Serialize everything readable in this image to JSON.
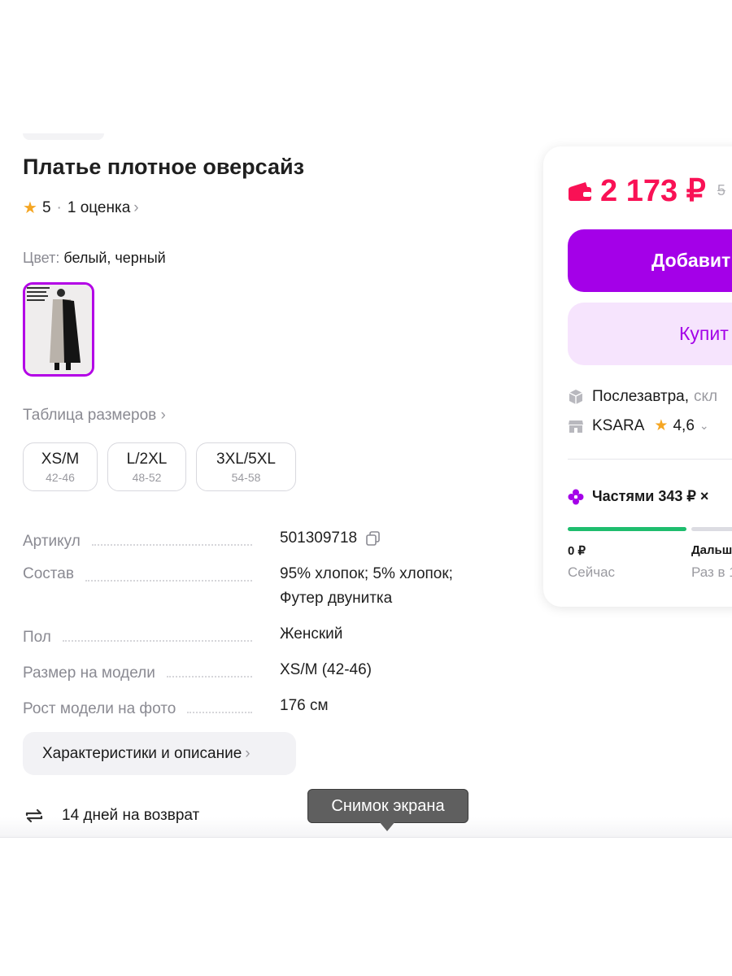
{
  "product": {
    "title": "Платье плотное оверсайз",
    "rating": "5",
    "reviews": "1 оценка",
    "color_label": "Цвет:",
    "color_value": "белый, черный"
  },
  "sizes": {
    "table_link": "Таблица размеров",
    "options": [
      {
        "size": "XS/M",
        "range": "42-46"
      },
      {
        "size": "L/2XL",
        "range": "48-52"
      },
      {
        "size": "3XL/5XL",
        "range": "54-58"
      }
    ]
  },
  "specs": [
    {
      "key": "Артикул",
      "value": "501309718"
    },
    {
      "key": "Состав",
      "value": "95% хлопок; 5% хлопок; Футер двунитка"
    },
    {
      "key": "Пол",
      "value": "Женский"
    },
    {
      "key": "Размер на модели",
      "value": "XS/M (42-46)"
    },
    {
      "key": "Рост модели на фото",
      "value": "176 см"
    }
  ],
  "description_button": "Характеристики и описание",
  "return_policy": "14 дней на возврат",
  "tooltip": "Снимок экрана",
  "card": {
    "price": "2 173 ₽",
    "old_price": "5",
    "add_button": "Добавит",
    "buy_button": "Купит",
    "delivery": "Послезавтра,",
    "delivery_extra": "скл",
    "seller_name": "KSARA",
    "seller_rating": "4,6",
    "installments": "Частями 343 ₽ ×",
    "pay_now_amount": "0 ₽",
    "pay_now_label": "Сейчас",
    "pay_later_amount": "Дальш",
    "pay_later_label": "Раз в 1"
  },
  "colors": {
    "accent": "#a400e8",
    "price": "#f91155",
    "progress": "#1ebd6e"
  }
}
